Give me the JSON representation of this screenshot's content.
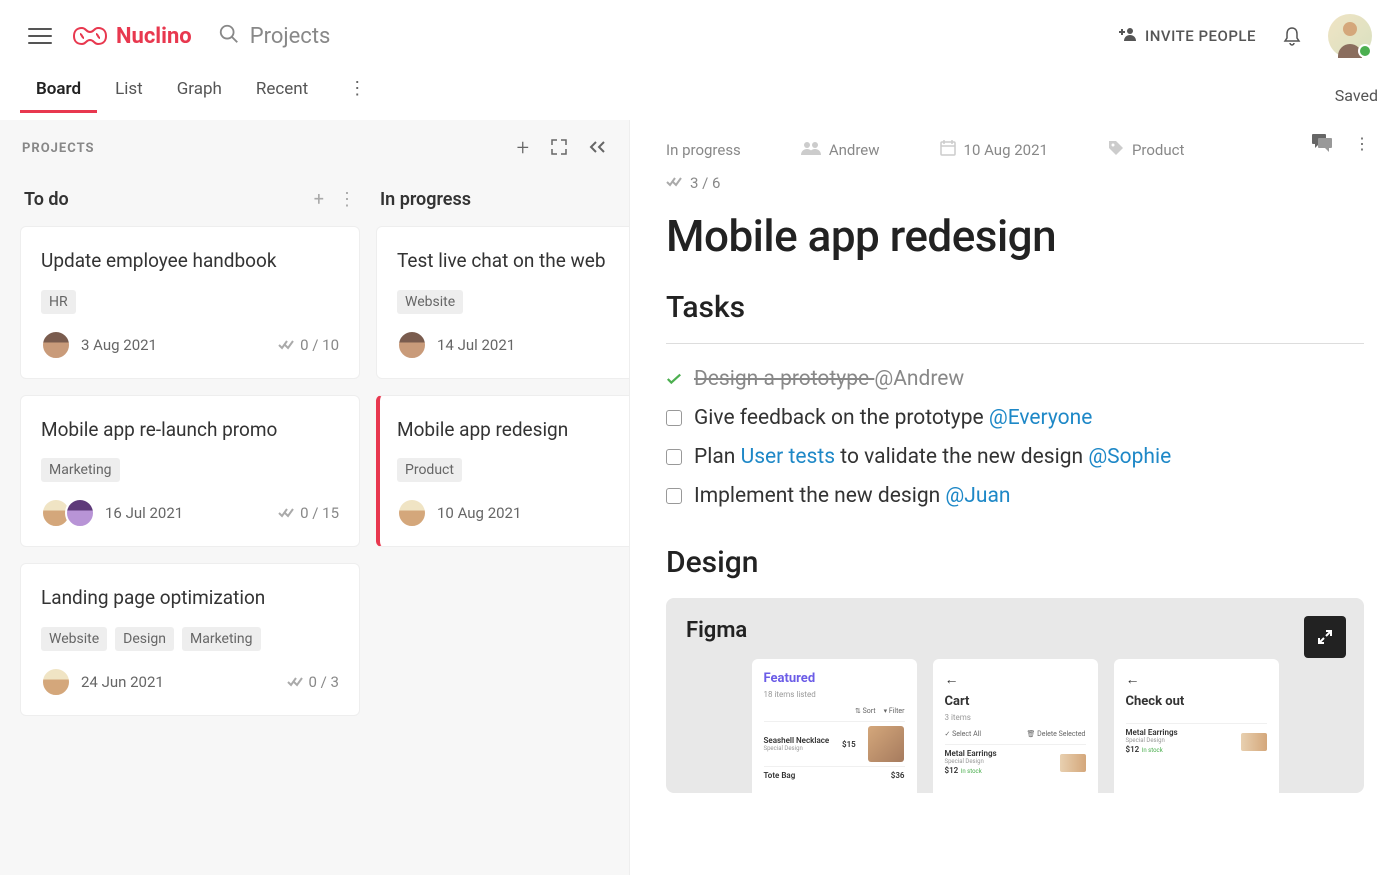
{
  "header": {
    "brand": "Nuclino",
    "search_label": "Projects",
    "invite_label": "INVITE PEOPLE"
  },
  "tabs": {
    "board": "Board",
    "list": "List",
    "graph": "Graph",
    "recent": "Recent",
    "saved": "Saved"
  },
  "board": {
    "title": "PROJECTS",
    "columns": [
      {
        "title": "To do",
        "cards": [
          {
            "title": "Update employee handbook",
            "tags": [
              "HR"
            ],
            "date": "3 Aug 2021",
            "count": "0 / 10",
            "avatars": [
              "a"
            ]
          },
          {
            "title": "Mobile app re-launch promo",
            "tags": [
              "Marketing"
            ],
            "date": "16 Jul 2021",
            "count": "0 / 15",
            "avatars": [
              "c",
              "b"
            ]
          },
          {
            "title": "Landing page optimization",
            "tags": [
              "Website",
              "Design",
              "Marketing"
            ],
            "date": "24 Jun 2021",
            "count": "0 / 3",
            "avatars": [
              "c"
            ]
          }
        ]
      },
      {
        "title": "In progress",
        "cards": [
          {
            "title": "Test live chat on the web",
            "tags": [
              "Website"
            ],
            "date": "14 Jul 2021",
            "count": "",
            "avatars": [
              "a"
            ]
          },
          {
            "title": "Mobile app redesign",
            "tags": [
              "Product"
            ],
            "date": "10 Aug 2021",
            "count": "",
            "avatars": [
              "c"
            ],
            "selected": true
          }
        ]
      }
    ]
  },
  "detail": {
    "status": "In progress",
    "assignee": "Andrew",
    "date": "10 Aug 2021",
    "tag": "Product",
    "progress": "3 / 6",
    "title": "Mobile app redesign",
    "tasks_heading": "Tasks",
    "tasks": [
      {
        "done": true,
        "text": "Design a prototype ",
        "mention": "@Andrew"
      },
      {
        "done": false,
        "text": "Give feedback on the prototype ",
        "mention": "@Everyone"
      },
      {
        "done": false,
        "prefix": "Plan ",
        "link": "User tests",
        "text": " to validate the new design ",
        "mention": "@Sophie"
      },
      {
        "done": false,
        "text": "Implement the new design ",
        "mention": "@Juan"
      }
    ],
    "design_heading": "Design",
    "embed_title": "Figma",
    "mockups": {
      "featured": {
        "title": "Featured",
        "sub": "18 items listed",
        "sort": "⇅ Sort",
        "filter": "▾ Filter",
        "i1": "Seashell Necklace",
        "i1sub": "Special Design",
        "p1": "$15",
        "i2": "Tote Bag",
        "p2": "$36"
      },
      "cart": {
        "title": "Cart",
        "sub": "3 items",
        "selall": "✓ Select All",
        "del": "🗑 Delete Selected",
        "i1": "Metal Earrings",
        "i1sub": "Special Design",
        "p1": "$12",
        "stock": "In stock"
      },
      "checkout": {
        "title": "Check out",
        "i1": "Metal Earrings",
        "i1sub": "Special Design",
        "p1": "$12",
        "stock": "In stock"
      }
    }
  }
}
